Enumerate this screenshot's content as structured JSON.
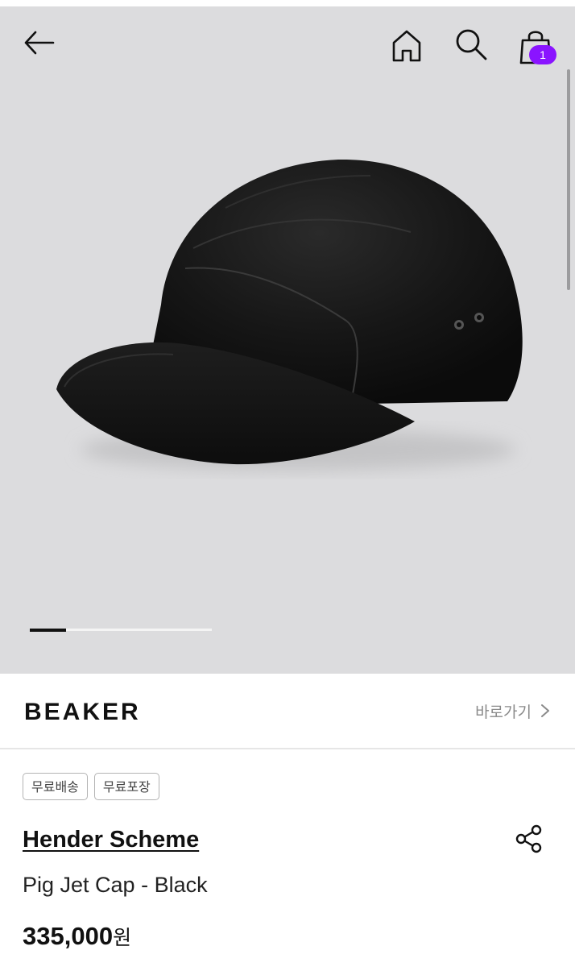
{
  "header": {
    "back_icon": "arrow-left-icon",
    "home_icon": "home-icon",
    "search_icon": "search-icon",
    "cart_icon": "shopping-bag-icon",
    "cart_count": "1",
    "badge_color": "#8a14ff"
  },
  "gallery": {
    "image_subject": "black suede five-panel jet cap",
    "background_color": "#dcdcde"
  },
  "brand_bar": {
    "logo_text": "BEAKER",
    "goto_label": "바로가기",
    "goto_icon": "chevron-right-icon"
  },
  "product": {
    "tags": [
      "무료배송",
      "무료포장"
    ],
    "brand": "Hender Scheme",
    "name": "Pig Jet Cap - Black",
    "price_value": "335,000",
    "price_unit": "원",
    "share_icon": "share-icon"
  }
}
